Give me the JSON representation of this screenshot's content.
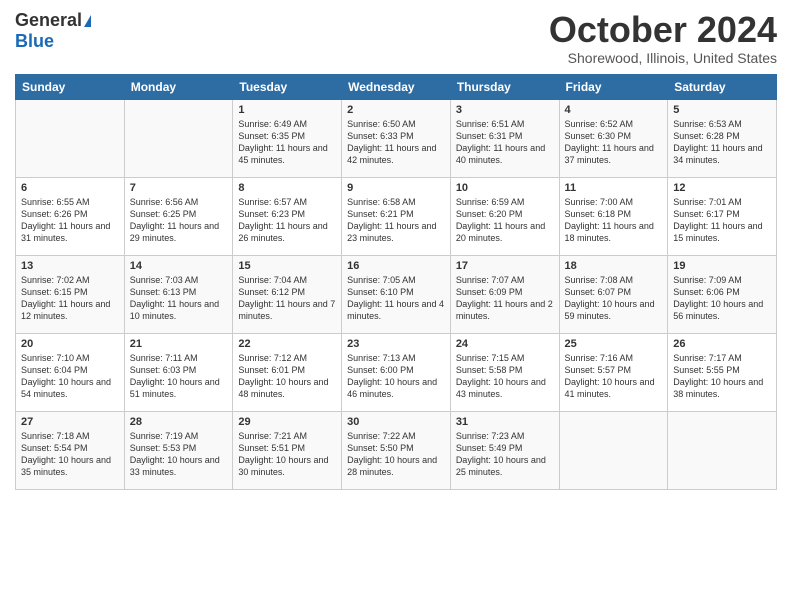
{
  "header": {
    "logo_general": "General",
    "logo_blue": "Blue",
    "month_title": "October 2024",
    "location": "Shorewood, Illinois, United States"
  },
  "days_of_week": [
    "Sunday",
    "Monday",
    "Tuesday",
    "Wednesday",
    "Thursday",
    "Friday",
    "Saturday"
  ],
  "weeks": [
    [
      {
        "day": "",
        "content": ""
      },
      {
        "day": "",
        "content": ""
      },
      {
        "day": "1",
        "content": "Sunrise: 6:49 AM\nSunset: 6:35 PM\nDaylight: 11 hours and 45 minutes."
      },
      {
        "day": "2",
        "content": "Sunrise: 6:50 AM\nSunset: 6:33 PM\nDaylight: 11 hours and 42 minutes."
      },
      {
        "day": "3",
        "content": "Sunrise: 6:51 AM\nSunset: 6:31 PM\nDaylight: 11 hours and 40 minutes."
      },
      {
        "day": "4",
        "content": "Sunrise: 6:52 AM\nSunset: 6:30 PM\nDaylight: 11 hours and 37 minutes."
      },
      {
        "day": "5",
        "content": "Sunrise: 6:53 AM\nSunset: 6:28 PM\nDaylight: 11 hours and 34 minutes."
      }
    ],
    [
      {
        "day": "6",
        "content": "Sunrise: 6:55 AM\nSunset: 6:26 PM\nDaylight: 11 hours and 31 minutes."
      },
      {
        "day": "7",
        "content": "Sunrise: 6:56 AM\nSunset: 6:25 PM\nDaylight: 11 hours and 29 minutes."
      },
      {
        "day": "8",
        "content": "Sunrise: 6:57 AM\nSunset: 6:23 PM\nDaylight: 11 hours and 26 minutes."
      },
      {
        "day": "9",
        "content": "Sunrise: 6:58 AM\nSunset: 6:21 PM\nDaylight: 11 hours and 23 minutes."
      },
      {
        "day": "10",
        "content": "Sunrise: 6:59 AM\nSunset: 6:20 PM\nDaylight: 11 hours and 20 minutes."
      },
      {
        "day": "11",
        "content": "Sunrise: 7:00 AM\nSunset: 6:18 PM\nDaylight: 11 hours and 18 minutes."
      },
      {
        "day": "12",
        "content": "Sunrise: 7:01 AM\nSunset: 6:17 PM\nDaylight: 11 hours and 15 minutes."
      }
    ],
    [
      {
        "day": "13",
        "content": "Sunrise: 7:02 AM\nSunset: 6:15 PM\nDaylight: 11 hours and 12 minutes."
      },
      {
        "day": "14",
        "content": "Sunrise: 7:03 AM\nSunset: 6:13 PM\nDaylight: 11 hours and 10 minutes."
      },
      {
        "day": "15",
        "content": "Sunrise: 7:04 AM\nSunset: 6:12 PM\nDaylight: 11 hours and 7 minutes."
      },
      {
        "day": "16",
        "content": "Sunrise: 7:05 AM\nSunset: 6:10 PM\nDaylight: 11 hours and 4 minutes."
      },
      {
        "day": "17",
        "content": "Sunrise: 7:07 AM\nSunset: 6:09 PM\nDaylight: 11 hours and 2 minutes."
      },
      {
        "day": "18",
        "content": "Sunrise: 7:08 AM\nSunset: 6:07 PM\nDaylight: 10 hours and 59 minutes."
      },
      {
        "day": "19",
        "content": "Sunrise: 7:09 AM\nSunset: 6:06 PM\nDaylight: 10 hours and 56 minutes."
      }
    ],
    [
      {
        "day": "20",
        "content": "Sunrise: 7:10 AM\nSunset: 6:04 PM\nDaylight: 10 hours and 54 minutes."
      },
      {
        "day": "21",
        "content": "Sunrise: 7:11 AM\nSunset: 6:03 PM\nDaylight: 10 hours and 51 minutes."
      },
      {
        "day": "22",
        "content": "Sunrise: 7:12 AM\nSunset: 6:01 PM\nDaylight: 10 hours and 48 minutes."
      },
      {
        "day": "23",
        "content": "Sunrise: 7:13 AM\nSunset: 6:00 PM\nDaylight: 10 hours and 46 minutes."
      },
      {
        "day": "24",
        "content": "Sunrise: 7:15 AM\nSunset: 5:58 PM\nDaylight: 10 hours and 43 minutes."
      },
      {
        "day": "25",
        "content": "Sunrise: 7:16 AM\nSunset: 5:57 PM\nDaylight: 10 hours and 41 minutes."
      },
      {
        "day": "26",
        "content": "Sunrise: 7:17 AM\nSunset: 5:55 PM\nDaylight: 10 hours and 38 minutes."
      }
    ],
    [
      {
        "day": "27",
        "content": "Sunrise: 7:18 AM\nSunset: 5:54 PM\nDaylight: 10 hours and 35 minutes."
      },
      {
        "day": "28",
        "content": "Sunrise: 7:19 AM\nSunset: 5:53 PM\nDaylight: 10 hours and 33 minutes."
      },
      {
        "day": "29",
        "content": "Sunrise: 7:21 AM\nSunset: 5:51 PM\nDaylight: 10 hours and 30 minutes."
      },
      {
        "day": "30",
        "content": "Sunrise: 7:22 AM\nSunset: 5:50 PM\nDaylight: 10 hours and 28 minutes."
      },
      {
        "day": "31",
        "content": "Sunrise: 7:23 AM\nSunset: 5:49 PM\nDaylight: 10 hours and 25 minutes."
      },
      {
        "day": "",
        "content": ""
      },
      {
        "day": "",
        "content": ""
      }
    ]
  ]
}
